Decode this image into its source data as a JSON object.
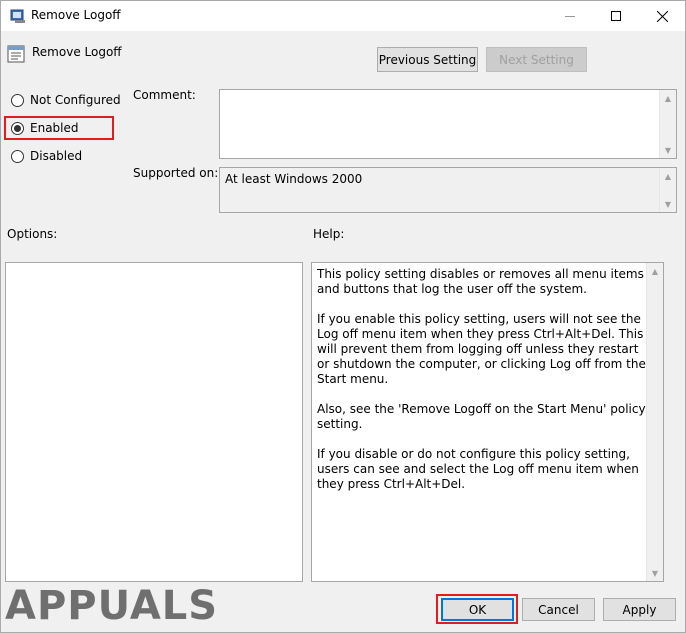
{
  "window": {
    "title": "Remove Logoff",
    "policy_name": "Remove Logoff"
  },
  "nav": {
    "previous_label": "Previous Setting",
    "next_label": "Next Setting"
  },
  "state": {
    "options": [
      {
        "label": "Not Configured",
        "checked": false
      },
      {
        "label": "Enabled",
        "checked": true
      },
      {
        "label": "Disabled",
        "checked": false
      }
    ]
  },
  "fields": {
    "comment_label": "Comment:",
    "comment_value": "",
    "supported_label": "Supported on:",
    "supported_value": "At least Windows 2000"
  },
  "sections": {
    "options_label": "Options:",
    "help_label": "Help:"
  },
  "help": {
    "paragraphs": [
      "This policy setting disables or removes all menu items and buttons that log the user off the system.",
      "If you enable this policy setting, users will not see the Log off menu item when they press Ctrl+Alt+Del. This will prevent them from logging off unless they restart or shutdown the computer, or clicking Log off from the Start menu.",
      "Also, see the 'Remove Logoff on the Start Menu' policy setting.",
      "If you disable or do not configure this policy setting, users can see and select the Log off menu item when they press Ctrl+Alt+Del."
    ]
  },
  "buttons": {
    "ok": "OK",
    "cancel": "Cancel",
    "apply": "Apply"
  },
  "watermark": {
    "text": "APPUALS"
  },
  "colors": {
    "highlight": "#e01e1e",
    "accent": "#0078d7"
  }
}
